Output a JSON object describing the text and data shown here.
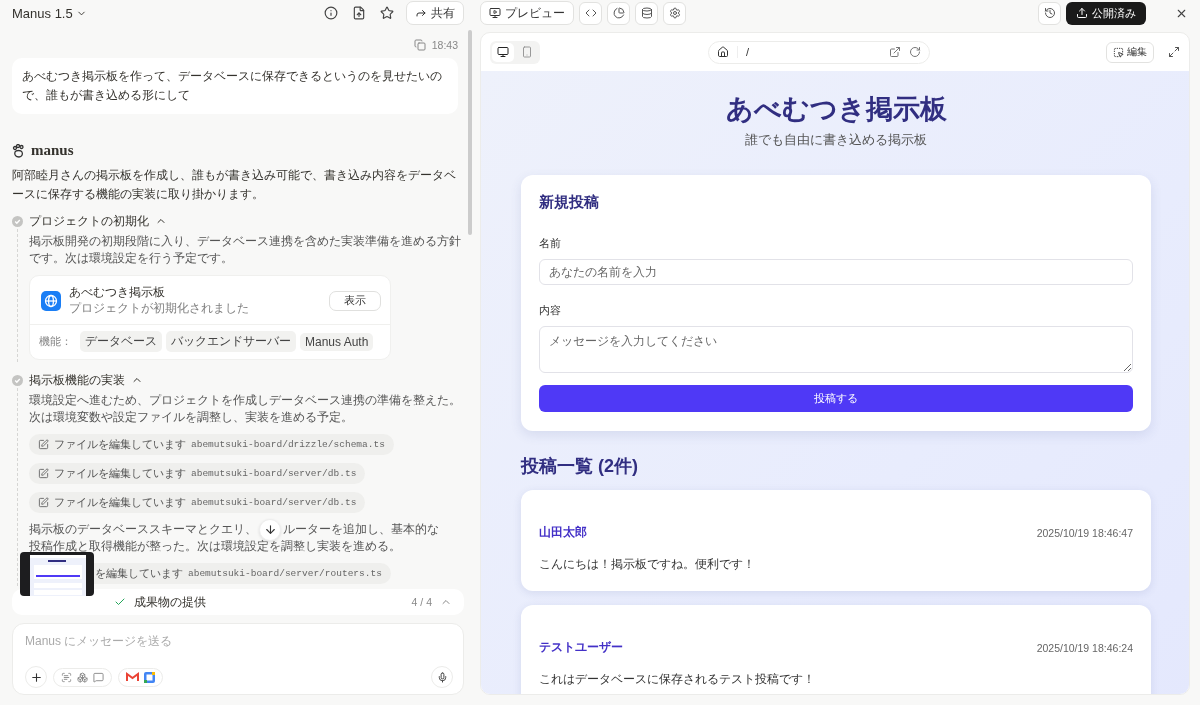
{
  "header": {
    "title": "Manus 1.5",
    "share": "共有"
  },
  "chat": {
    "time": "18:43",
    "user_message": "あべむつき掲示板を作って、データベースに保存できるというのを見せたいので、誰もが書き込める形にして",
    "agent_name": "manus",
    "agent_intro": "阿部睦月さんの掲示板を作成し、誰もが書き込み可能で、書き込み内容をデータベースに保存する機能の実装に取り掛かります。",
    "steps": [
      {
        "title": "プロジェクトの初期化",
        "done": true,
        "expanded": true,
        "items": [
          {
            "kind": "text",
            "text": "掲示板開発の初期段階に入り、データベース連携を含めた実装準備を進める方針です。次は環境設定を行う予定です。"
          },
          {
            "kind": "project_card",
            "title": "あべむつき掲示板",
            "subtitle": "プロジェクトが初期化されました",
            "button": "表示",
            "features_label": "機能：",
            "features": [
              "データベース",
              "バックエンドサーバー",
              "Manus Auth"
            ]
          }
        ]
      },
      {
        "title": "掲示板機能の実装",
        "done": true,
        "expanded": true,
        "items": [
          {
            "kind": "text",
            "text": "環境設定へ進むため、プロジェクトを作成しデータベース連携の準備を整えた。次は環境変数や設定ファイルを調整し、実装を進める予定。"
          },
          {
            "kind": "file_edit",
            "covered": false,
            "action": "ファイルを編集しています",
            "path": "abemutsuki-board/drizzle/schema.ts"
          },
          {
            "kind": "file_edit",
            "covered": false,
            "action": "ファイルを編集しています",
            "path": "abemutsuki-board/server/db.ts"
          },
          {
            "kind": "file_edit",
            "covered": false,
            "action": "ファイルを編集しています",
            "path": "abemutsuki-board/server/db.ts"
          },
          {
            "kind": "split_text",
            "parts": [
              "掲示板のデータベーススキーマとクエリ、",
              "ルーターを追加し、基本的な",
              "投稿作成と取得機能が整った。次は環境設定を調整し実装を進める。"
            ]
          },
          {
            "kind": "file_edit",
            "covered": true,
            "action": "を編集しています",
            "path": "abemutsuki-board/server/routers.ts"
          }
        ]
      }
    ]
  },
  "task_bar": {
    "label": "成果物の提供",
    "done": true,
    "progress": "4 / 4"
  },
  "composer": {
    "placeholder": "Manus にメッセージを送る"
  },
  "preview": {
    "tab": "プレビュー",
    "publish": "公開済み",
    "path": "/",
    "edit": "編集",
    "devices": [
      {
        "kind": "desktop",
        "selected": true
      },
      {
        "kind": "mobile",
        "selected": false
      }
    ],
    "site": {
      "title": "あべむつき掲示板",
      "subtitle": "誰でも自由に書き込める掲示板",
      "form": {
        "heading": "新規投稿",
        "name_label": "名前",
        "name_placeholder": "あなたの名前を入力",
        "content_label": "内容",
        "content_placeholder": "メッセージを入力してください",
        "submit": "投稿する"
      },
      "list_heading": "投稿一覧 (2件)",
      "posts": [
        {
          "author": "山田太郎",
          "time": "2025/10/19 18:46:47",
          "body": "こんにちは！掲示板ですね。便利です！"
        },
        {
          "author": "テストユーザー",
          "time": "2025/10/19 18:46:24",
          "body": "これはデータベースに保存されるテスト投稿です！"
        }
      ]
    }
  }
}
